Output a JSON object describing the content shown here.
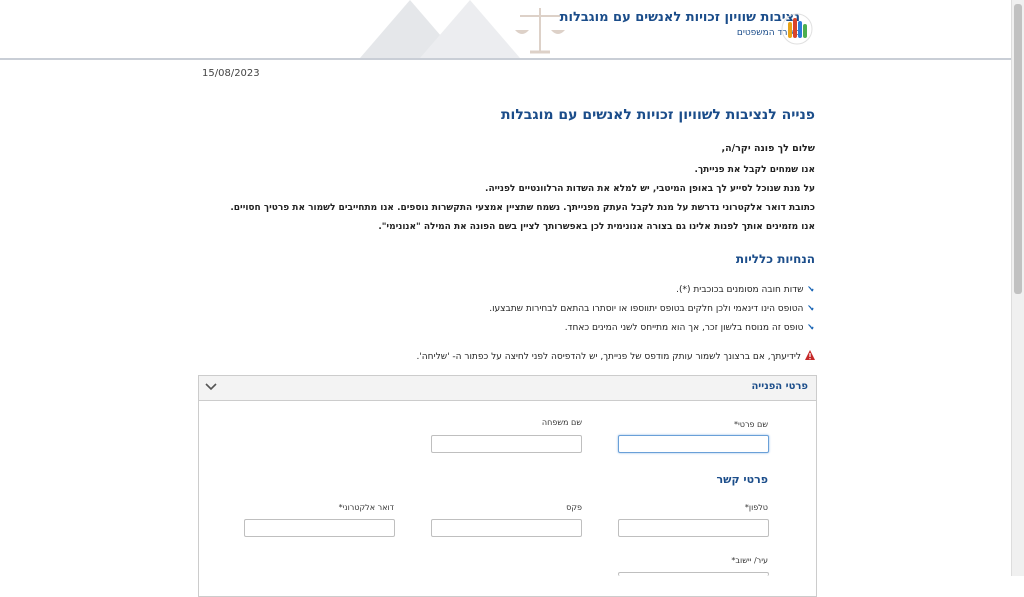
{
  "header": {
    "title": "נציבות שוויון זכויות לאנשים עם מוגבלות",
    "subtitle": "משרד המשפטים",
    "logo_icon": "equality-logo-icon",
    "background_icon": "scales-of-justice-icon"
  },
  "date": "15/08/2023",
  "page_title": "פנייה לנציבות לשוויון זכויות לאנשים עם מוגבלות",
  "intro": {
    "greeting": "שלום לך פונה יקר/ה,",
    "paragraphs": [
      "אנו שמחים לקבל את פנייתך.",
      "על מנת שנוכל לסייע לך באופן המיטבי, יש למלא את השדות הרלוונטיים לפנייה.",
      "כתובת דואר אלקטרוני נדרשת על מנת לקבל העתק מפנייתך. נשמח שתציין אמצעי התקשרות נוספים. אנו מתחייבים לשמור את פרטיך חסויים.",
      "אנו מזמינים אותך לפנות אלינו גם בצורה אנונימית לכן באפשרותך לציין בשם הפונה את המילה \"אנונימי\"."
    ]
  },
  "guidelines": {
    "title": "הנחיות כלליות",
    "items": [
      "שדות חובה מסומנים בכוכבית (*).",
      "הטופס הינו דינאמי ולכן חלקים בטופס יתווספו או יוסתרו בהתאם לבחירות שתבצעו.",
      "טופס זה מנוסח בלשון זכר, אך הוא מתייחס לשני המינים כאחד."
    ],
    "bullet_icon": "check-icon"
  },
  "notice": {
    "icon": "warning-icon",
    "text": "לידיעתך, אם ברצונך לשמור עותק מודפס של פנייתך, יש להדפיסה לפני לחיצה על כפתור ה- 'שליחה'."
  },
  "form": {
    "panel_title": "פרטי הפנייה",
    "first_name_label": "שם פרטי*",
    "last_name_label": "שם משפחה",
    "contact_title": "פרטי קשר",
    "phone_label": "טלפון*",
    "fax_label": "פקס",
    "email_label": "דואר אלקטרוני*",
    "city_label": "עיר/ יישוב*"
  },
  "colors": {
    "brand_blue": "#1b4d8a",
    "check_blue": "#1b66b5",
    "warning_red": "#c62828",
    "focus_border": "#6aa0d8"
  }
}
